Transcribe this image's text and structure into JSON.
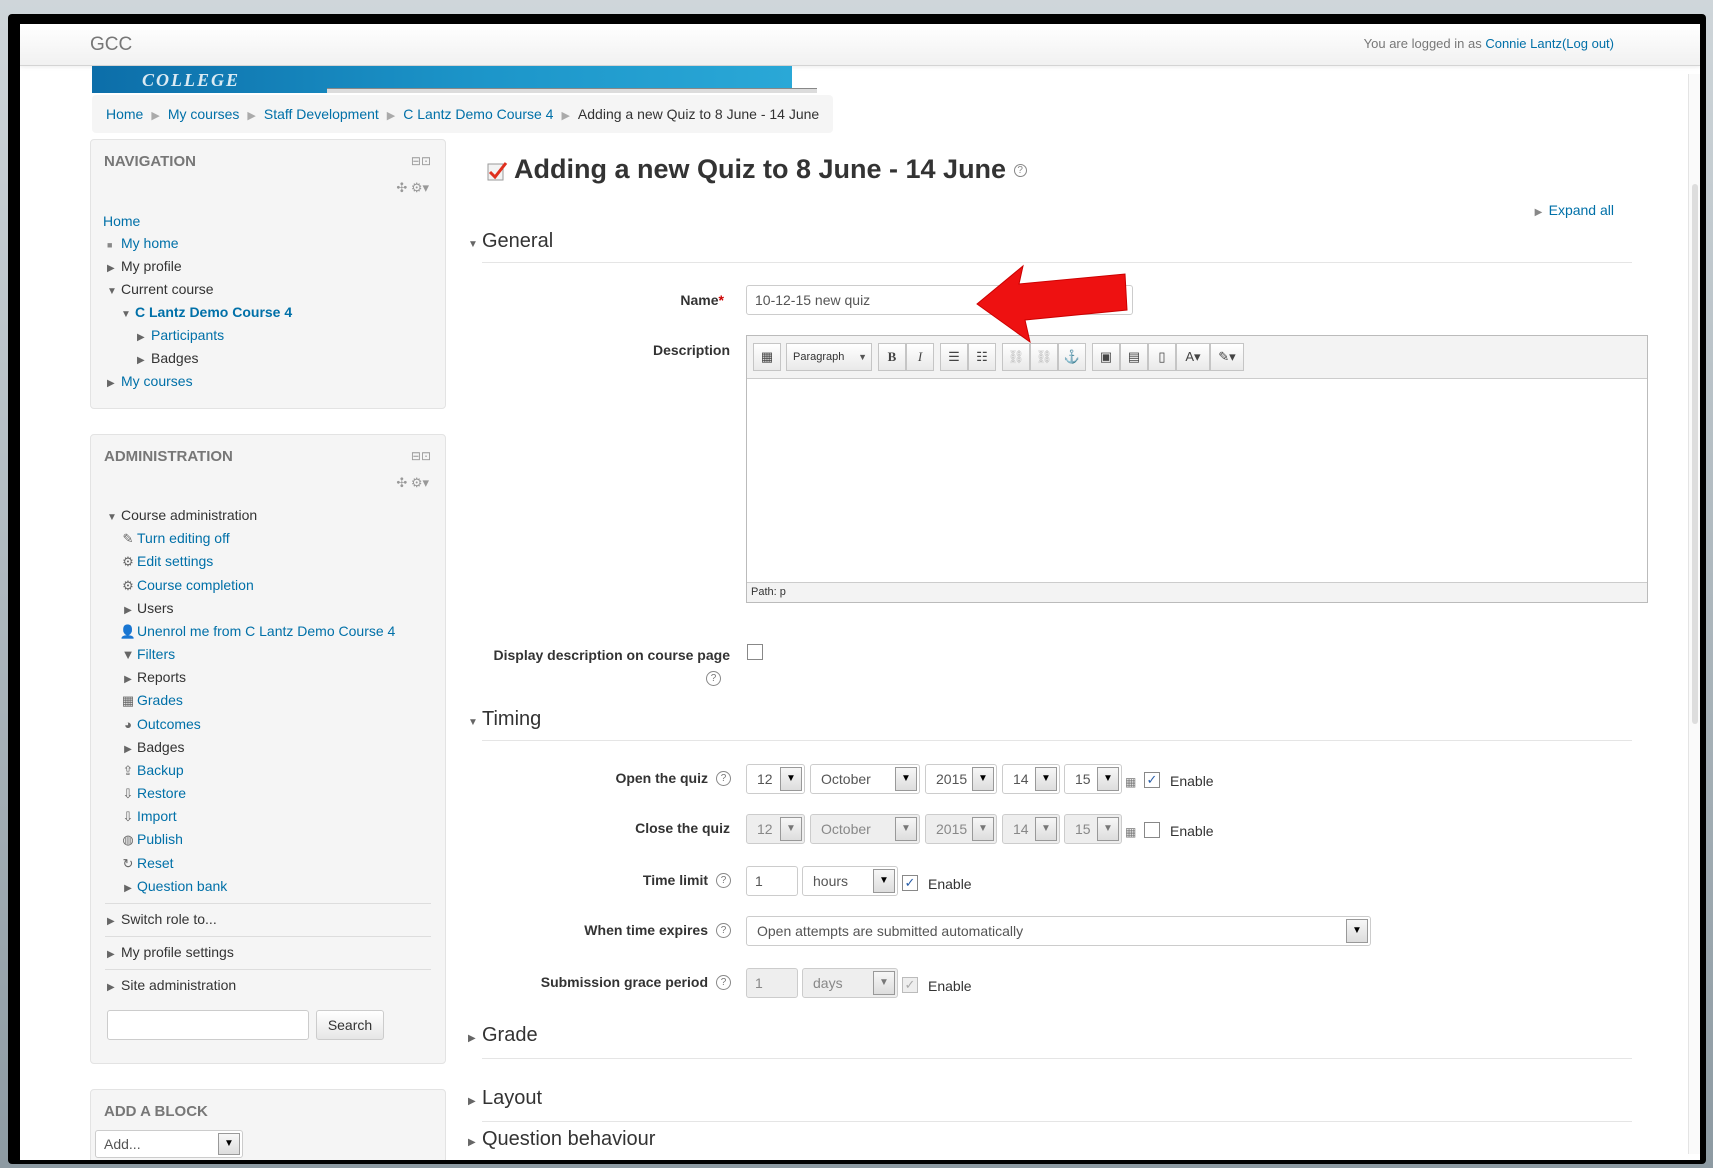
{
  "site": {
    "brand": "GCC",
    "login_prefix": "You are logged in as",
    "user": "Connie Lantz",
    "logout": "(Log out)",
    "banner_text": "COLLEGE"
  },
  "breadcrumb": [
    "Home",
    "My courses",
    "Staff Development",
    "C Lantz Demo Course 4",
    "Adding a new Quiz to 8 June - 14 June"
  ],
  "navigation": {
    "title": "NAVIGATION",
    "home": "Home",
    "my_home": "My home",
    "my_profile": "My profile",
    "current_course": "Current course",
    "course": "C Lantz Demo Course 4",
    "participants": "Participants",
    "badges": "Badges",
    "my_courses": "My courses"
  },
  "administration": {
    "title": "ADMINISTRATION",
    "course_admin": "Course administration",
    "items": [
      "Turn editing off",
      "Edit settings",
      "Course completion",
      "Users",
      "Unenrol me from C Lantz Demo Course 4",
      "Filters",
      "Reports",
      "Grades",
      "Outcomes",
      "Badges",
      "Backup",
      "Restore",
      "Import",
      "Publish",
      "Reset",
      "Question bank"
    ],
    "switch_role": "Switch role to...",
    "my_profile_settings": "My profile settings",
    "site_admin": "Site administration",
    "search_button": "Search"
  },
  "add_block": {
    "title": "ADD A BLOCK",
    "select_value": "Add..."
  },
  "page": {
    "title": "Adding a new Quiz to 8 June - 14 June",
    "expand_all": "Expand all"
  },
  "general": {
    "heading": "General",
    "name_label": "Name",
    "name_value": "10-12-15 new quiz",
    "description_label": "Description",
    "paragraph": "Paragraph",
    "path": "Path: p",
    "display_desc_label": "Display description on course page"
  },
  "timing": {
    "heading": "Timing",
    "open_label": "Open the quiz",
    "open": {
      "day": "12",
      "month": "October",
      "year": "2015",
      "hour": "14",
      "minute": "15",
      "enable": "Enable",
      "enabled": true
    },
    "close_label": "Close the quiz",
    "close": {
      "day": "12",
      "month": "October",
      "year": "2015",
      "hour": "14",
      "minute": "15",
      "enable": "Enable",
      "enabled": false
    },
    "time_limit_label": "Time limit",
    "time_limit_value": "1",
    "time_limit_unit": "hours",
    "time_limit_enable": "Enable",
    "expires_label": "When time expires",
    "expires_value": "Open attempts are submitted automatically",
    "grace_label": "Submission grace period",
    "grace_value": "1",
    "grace_unit": "days",
    "grace_enable": "Enable"
  },
  "collapsed_sections": [
    "Grade",
    "Layout",
    "Question behaviour"
  ],
  "colors": {
    "link": "#0070a8",
    "arrow": "#ee1111",
    "required": "#cc0000"
  }
}
